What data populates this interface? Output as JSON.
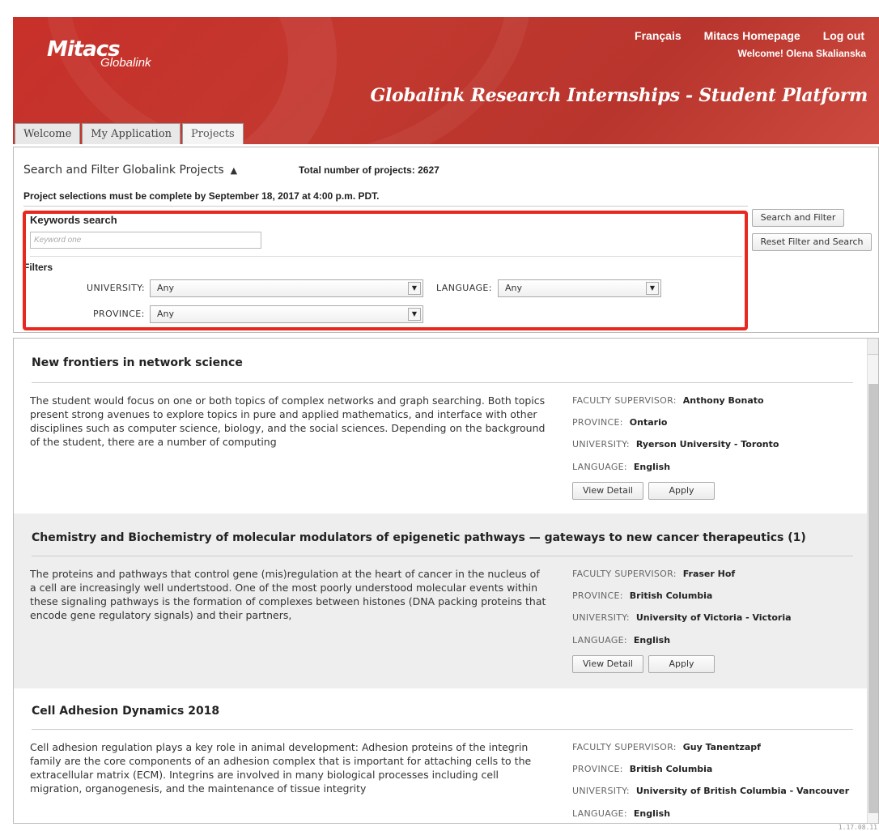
{
  "header": {
    "logo_main": "Mitacs",
    "logo_sub": "Globalink",
    "links": [
      "Français",
      "Mitacs Homepage",
      "Log out"
    ],
    "welcome": "Welcome! Olena Skalianska",
    "platform_title": "Globalink Research Internships - Student Platform",
    "tabs": [
      "Welcome",
      "My Application",
      "Projects"
    ]
  },
  "filter_panel": {
    "title": "Search and Filter Globalink Projects",
    "collapse_arrow": "▲",
    "total": "Total number of projects: 2627",
    "deadline": "Project selections must be complete by September 18, 2017 at 4:00 p.m. PDT.",
    "keywords_label": "Keywords search",
    "keyword_placeholder": "Keyword one",
    "filters_label": "Filters",
    "university_label": "UNIVERSITY:",
    "university_value": "Any",
    "language_label": "LANGUAGE:",
    "language_value": "Any",
    "province_label": "PROVINCE:",
    "province_value": "Any",
    "search_button": "Search and Filter",
    "reset_button": "Reset Filter and Search"
  },
  "meta_labels": {
    "supervisor": "FACULTY SUPERVISOR:",
    "province": "PROVINCE:",
    "university": "UNIVERSITY:",
    "language": "LANGUAGE:"
  },
  "buttons": {
    "view_detail": "View Detail",
    "apply": "Apply"
  },
  "projects": [
    {
      "title": "New frontiers in network science",
      "description": "The student would focus on one or both topics of complex networks and graph searching. Both topics present strong avenues to explore topics in pure and applied mathematics, and interface with other disciplines such as computer science, biology, and the social sciences. Depending on the background of the student, there are a number of computing",
      "supervisor": "Anthony Bonato",
      "province": "Ontario",
      "university": "Ryerson University - Toronto",
      "language": "English"
    },
    {
      "title": "Chemistry and Biochemistry of molecular modulators of epigenetic pathways — gateways to new cancer therapeutics (1)",
      "description": "The proteins and pathways that control gene (mis)regulation at the heart of cancer in the nucleus of a cell are increasingly well undertstood. One of the most poorly understood molecular events within these signaling pathways is the formation of complexes between histones (DNA packing proteins that encode gene regulatory signals) and their partners,",
      "supervisor": "Fraser Hof",
      "province": "British Columbia",
      "university": "University of Victoria - Victoria",
      "language": "English"
    },
    {
      "title": "Cell Adhesion Dynamics 2018",
      "description": "Cell adhesion regulation plays a key role in animal development: Adhesion proteins of the integrin family are the core components of an adhesion complex that is important for attaching cells to the extracellular matrix (ECM). Integrins are involved in many biological processes including cell migration, organogenesis, and the maintenance of tissue integrity",
      "supervisor": "Guy Tanentzapf",
      "province": "British Columbia",
      "university": "University of British Columbia - Vancouver",
      "language": "English"
    }
  ],
  "build_label": "1.17.08.11",
  "colors": {
    "header_red": "#c8302a",
    "highlight_red": "#e8281e",
    "shaded_row": "#eeeeee"
  }
}
